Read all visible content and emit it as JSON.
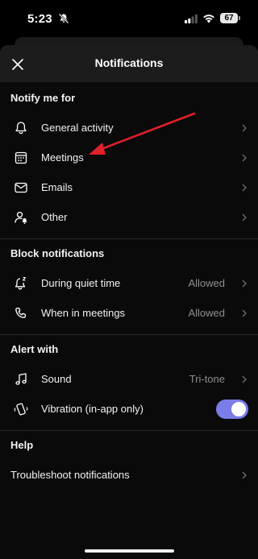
{
  "status_bar": {
    "time": "5:23",
    "battery": "67"
  },
  "header": {
    "title": "Notifications"
  },
  "sections": {
    "notify": {
      "title": "Notify me for",
      "items": [
        {
          "label": "General activity",
          "icon": "bell-icon"
        },
        {
          "label": "Meetings",
          "icon": "calendar-icon"
        },
        {
          "label": "Emails",
          "icon": "mail-icon"
        },
        {
          "label": "Other",
          "icon": "person-bell-icon"
        }
      ]
    },
    "block": {
      "title": "Block notifications",
      "items": [
        {
          "label": "During quiet time",
          "value": "Allowed",
          "icon": "quiet-bell-icon"
        },
        {
          "label": "When in meetings",
          "value": "Allowed",
          "icon": "phone-icon"
        }
      ]
    },
    "alert": {
      "title": "Alert with",
      "items": [
        {
          "label": "Sound",
          "value": "Tri-tone",
          "icon": "music-note-icon"
        },
        {
          "label": "Vibration (in-app only)",
          "icon": "vibration-icon",
          "toggle_on": true
        }
      ]
    },
    "help": {
      "title": "Help",
      "items": [
        {
          "label": "Troubleshoot notifications"
        }
      ]
    }
  },
  "colors": {
    "background": "#000000",
    "toggle_accent": "#7a7ce8",
    "annotation_arrow": "#e0202a",
    "secondary_text": "#8e8e8e"
  }
}
